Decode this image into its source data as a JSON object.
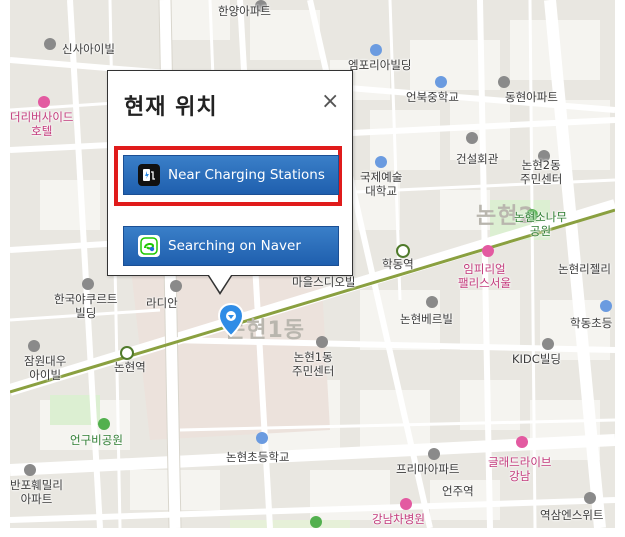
{
  "popup": {
    "title": "현재 위치",
    "close_glyph": "×",
    "buttons": {
      "charging": "Near Charging Stations",
      "naver": "Searching on Naver"
    }
  },
  "map": {
    "district_labels": {
      "nonhyeon1": "논현1동",
      "nonhyeon2": "논현2"
    },
    "labels": {
      "hanyang_apt": "한양아파트",
      "sinsa_building": "신사아이빌",
      "empori": "엠포리아빌딩",
      "eonbuk_middle": "언북중학교",
      "dongheon_apt": "동현아파트",
      "the_river_side": "더리버사이드\n호텔",
      "geonseol": "건설회관",
      "nonhyeon2_center": "논현2동\n주민센터",
      "art_univ": "국제예술\n대학교",
      "nonhyeon_park": "논현소나무\n공원",
      "hakdong_station": "학동역",
      "maeul_studio": "마을스디오빌",
      "imperial_palace": "임피리얼\n팰리스서울",
      "nonhyeon_jelly": "논현리젤리",
      "korea_yakult": "한국야쿠르트\n빌딩",
      "radian": "라디안",
      "hakdong_cho": "학동초등",
      "nonhyeon_verdi": "논현베르빌",
      "jamwon": "잠원대우\n아이빌",
      "nonhyeon_station": "논현역",
      "nonhyeon1_center": "논현1동\n주민센터",
      "kidc": "KIDC빌딩",
      "eongu_park": "언구비공원",
      "nonhyeon_elem": "논현초등학교",
      "prima_apt": "프리마아파트",
      "glad_live": "글래드라이브\n강남",
      "hanpo": "반포훼밀리\n아파트",
      "eonju_station": "언주역",
      "gangnam_hospital": "강남차병원",
      "yeoksam": "역삼엔스위트"
    }
  },
  "colors": {
    "button_blue": "#2a6ebc",
    "highlight_red": "#e01b1b",
    "subway_line": "#8aa040",
    "pin_blue": "#2f8ce6"
  },
  "icons": [
    "ev-charger-icon",
    "naver-map-icon",
    "location-pin-icon",
    "close-icon"
  ]
}
